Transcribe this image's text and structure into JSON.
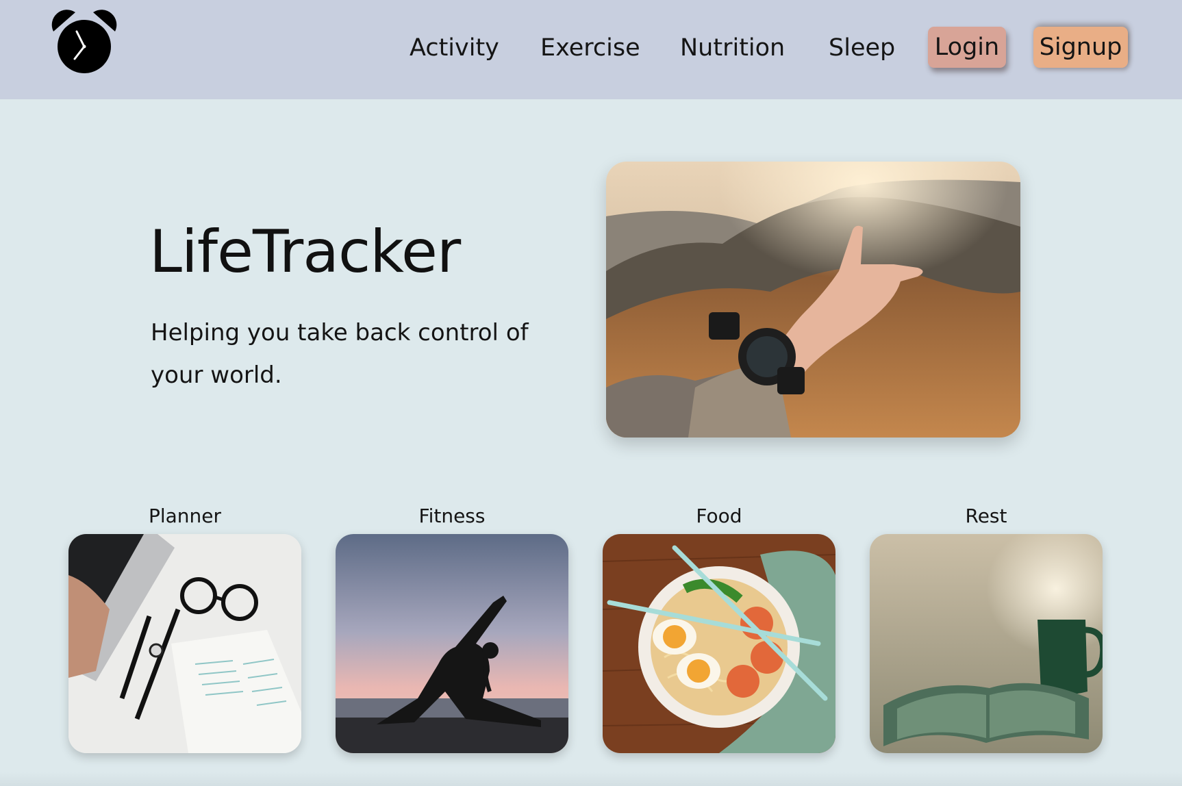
{
  "app": {
    "name": "LifeTracker",
    "logo_icon": "alarm-clock-icon"
  },
  "nav": {
    "links": [
      "Activity",
      "Exercise",
      "Nutrition",
      "Sleep"
    ],
    "login_label": "Login",
    "signup_label": "Signup",
    "login_color": "#d8a497",
    "signup_color": "#e9ae86"
  },
  "hero": {
    "title": "LifeTracker",
    "subtitle": "Helping you take back control of your world.",
    "image": "hiker-wristwatch-mountain-photo"
  },
  "cards": [
    {
      "label": "Planner",
      "image": "laptop-glasses-watch-planner-photo"
    },
    {
      "label": "Fitness",
      "image": "yoga-silhouette-sunset-photo"
    },
    {
      "label": "Food",
      "image": "ramen-bowl-chopsticks-photo"
    },
    {
      "label": "Rest",
      "image": "mug-open-book-photo"
    }
  ],
  "colors": {
    "navbar_bg": "#c8cfdf",
    "page_bg": "#dde9ec"
  }
}
